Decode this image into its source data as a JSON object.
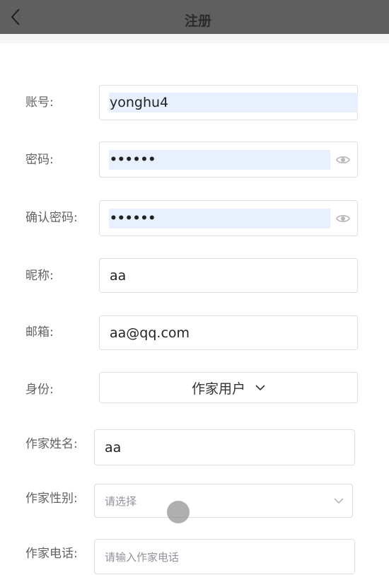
{
  "header": {
    "title": "注册",
    "back_icon": "chevron-left-icon"
  },
  "form": {
    "account": {
      "label": "账号:",
      "value": "yonghu4"
    },
    "password": {
      "label": "密码:",
      "value": "••••••",
      "icon": "eye-icon"
    },
    "confirm_password": {
      "label": "确认密码:",
      "value": "••••••",
      "icon": "eye-icon"
    },
    "nickname": {
      "label": "昵称:",
      "value": "aa"
    },
    "email": {
      "label": "邮箱:",
      "value": "aa@qq.com"
    },
    "identity": {
      "label": "身份:",
      "value": "作家用户",
      "icon": "chevron-down-icon"
    },
    "writer_name": {
      "label": "作家姓名:",
      "value": "aa"
    },
    "writer_gender": {
      "label": "作家性别:",
      "placeholder": "请选择",
      "icon": "chevron-down-icon"
    },
    "writer_phone": {
      "label": "作家电话:",
      "placeholder": "请输入作家电话"
    }
  },
  "colors": {
    "header_bg": "#5f5f5f",
    "autofill_bg": "#e8f0fe",
    "border": "#dcdfe6",
    "label": "#606266",
    "placeholder": "#909399"
  }
}
